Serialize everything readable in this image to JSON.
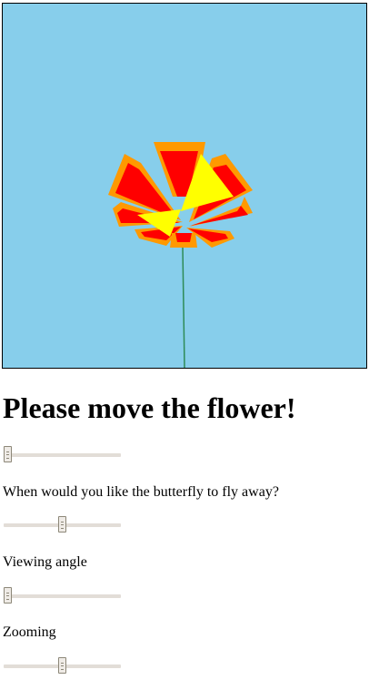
{
  "scene": {
    "sky_color": "#87ceeb",
    "stem_color": "#2e8b57",
    "petal_outer_color": "#ff9900",
    "petal_inner_color": "#ff0000",
    "wing_color": "#ffff00"
  },
  "page": {
    "heading": "Please move the flower!"
  },
  "controls": {
    "move_flower": {
      "value": 0
    },
    "butterfly": {
      "label": "When would you like the butterfly to fly away?",
      "value": 0.5
    },
    "viewing_angle": {
      "label": "Viewing angle",
      "value": 0
    },
    "zooming": {
      "label": "Zooming",
      "value": 0.5
    }
  }
}
